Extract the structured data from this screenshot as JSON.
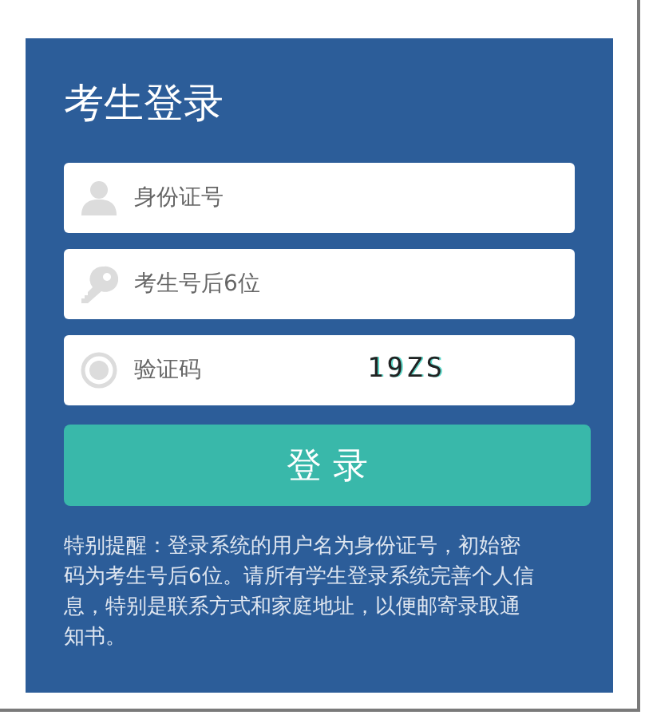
{
  "title": "考生登录",
  "fields": [
    {
      "kind": "user",
      "placeholder": "身份证号"
    },
    {
      "kind": "key",
      "placeholder": "考生号后6位"
    },
    {
      "kind": "captcha",
      "placeholder": "验证码",
      "captcha": "19ZS"
    }
  ],
  "login_button": "登 录",
  "notice": "特别提醒：登录系统的用户名为身份证号，初始密码为考生号后6位。请所有学生登录系统完善个人信息，特别是联系方式和家庭地址，以便邮寄录取通知书。"
}
